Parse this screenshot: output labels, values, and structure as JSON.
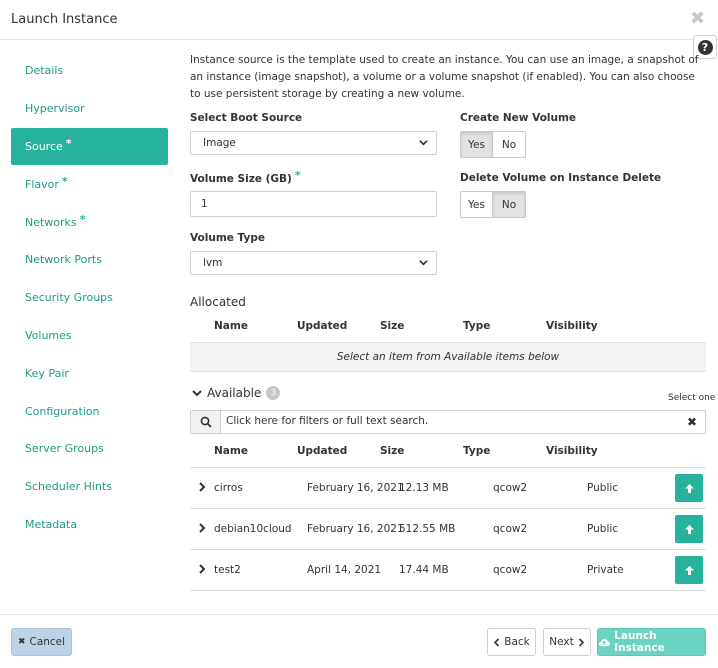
{
  "modal": {
    "title": "Launch Instance",
    "close_glyph": "✖",
    "help_glyph": "?"
  },
  "nav": {
    "items": [
      {
        "label": "Details",
        "required": false,
        "active": false
      },
      {
        "label": "Hypervisor",
        "required": false,
        "active": false
      },
      {
        "label": "Source",
        "required": true,
        "active": true
      },
      {
        "label": "Flavor",
        "required": true,
        "active": false
      },
      {
        "label": "Networks",
        "required": true,
        "active": false
      },
      {
        "label": "Network Ports",
        "required": false,
        "active": false
      },
      {
        "label": "Security Groups",
        "required": false,
        "active": false
      },
      {
        "label": "Volumes",
        "required": false,
        "active": false
      },
      {
        "label": "Key Pair",
        "required": false,
        "active": false
      },
      {
        "label": "Configuration",
        "required": false,
        "active": false
      },
      {
        "label": "Server Groups",
        "required": false,
        "active": false
      },
      {
        "label": "Scheduler Hints",
        "required": false,
        "active": false
      },
      {
        "label": "Metadata",
        "required": false,
        "active": false
      }
    ],
    "required_marker": "*"
  },
  "source": {
    "description": "Instance source is the template used to create an instance. You can use an image, a snapshot of an instance (image snapshot), a volume or a volume snapshot (if enabled). You can also choose to use persistent storage by creating a new volume.",
    "boot_source": {
      "label": "Select Boot Source",
      "value": "Image"
    },
    "create_volume": {
      "label": "Create New Volume",
      "yes": "Yes",
      "no": "No",
      "selected": "yes"
    },
    "volume_size": {
      "label": "Volume Size (GB)",
      "value": "1",
      "required_marker": "*"
    },
    "delete_on_terminate": {
      "label": "Delete Volume on Instance Delete",
      "yes": "Yes",
      "no": "No",
      "selected": "no"
    },
    "volume_type": {
      "label": "Volume Type",
      "value": "lvm"
    }
  },
  "allocated": {
    "title": "Allocated",
    "columns": [
      "Name",
      "Updated",
      "Size",
      "Type",
      "Visibility"
    ],
    "empty_message": "Select an item from Available items below"
  },
  "available": {
    "title": "Available",
    "count": "3",
    "select_hint": "Select one",
    "search_placeholder": "Click here for filters or full text search.",
    "columns": [
      "Name",
      "Updated",
      "Size",
      "Type",
      "Visibility"
    ],
    "rows": [
      {
        "name": "cirros",
        "updated": "February 16, 2021",
        "size": "12.13 MB",
        "type": "qcow2",
        "visibility": "Public"
      },
      {
        "name": "debian10cloud",
        "updated": "February 16, 2021",
        "size": "512.55 MB",
        "type": "qcow2",
        "visibility": "Public"
      },
      {
        "name": "test2",
        "updated": "April 14, 2021",
        "size": "17.44 MB",
        "type": "qcow2",
        "visibility": "Private"
      }
    ]
  },
  "footer": {
    "cancel": "Cancel",
    "back": "Back",
    "next": "Next",
    "launch": "Launch Instance"
  },
  "colors": {
    "accent": "#27b39b",
    "launch_button": "#6ad3c2",
    "cancel_button": "#bcd3e6"
  },
  "icons": [
    "close-icon",
    "help-icon",
    "chevron-down-icon",
    "chevron-down-icon",
    "search-icon",
    "clear-icon",
    "chevron-right-icon",
    "arrow-up-icon",
    "close-icon",
    "chevron-left-icon",
    "chevron-right-icon",
    "cloud-upload-icon"
  ]
}
